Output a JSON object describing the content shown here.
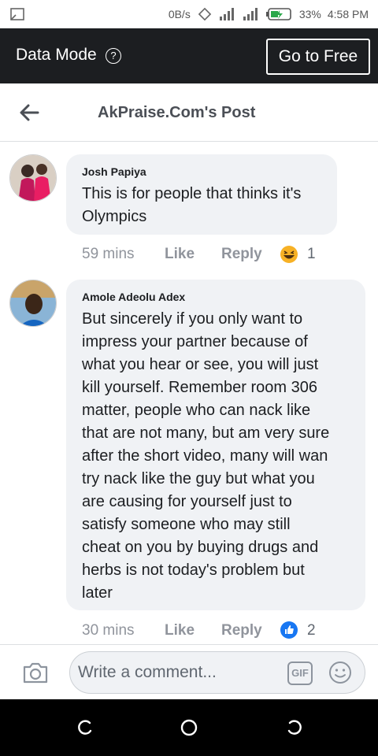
{
  "status_bar": {
    "network_speed": "0B/s",
    "battery": "33%",
    "time": "4:58 PM"
  },
  "data_mode_bar": {
    "label": "Data Mode",
    "cta_label": "Go to Free"
  },
  "header": {
    "title": "AkPraise.Com's Post"
  },
  "comments": [
    {
      "author": "Josh Papiya",
      "text_lines": [
        "This is for people that thinks it's",
        "Olympics"
      ],
      "time": "59 mins",
      "like_label": "Like",
      "reply_label": "Reply",
      "reaction_icon": "haha-emoji-icon",
      "reaction_count": "1"
    },
    {
      "author": "Amole Adeolu Adex",
      "text_lines": [
        "But sincerely if you only want to",
        "impress your partner because of",
        "what you hear or see, you will just",
        "kill yourself. Remember room 306",
        "matter, people who can nack like",
        "that are not many, but am very sure",
        "after the short video, many will wan",
        "try nack like the guy but what you",
        "are causing for yourself just to",
        "satisfy someone who may still",
        "cheat on you by buying drugs and",
        "herbs is not today's problem but",
        "later"
      ],
      "time": "30 mins",
      "like_label": "Like",
      "reply_label": "Reply",
      "reaction_icon": "like-thumb-icon",
      "reaction_count": "2"
    }
  ],
  "composer": {
    "placeholder": "Write a comment...",
    "gif_label": "GIF"
  },
  "colors": {
    "data_bar_bg": "#1c1e21",
    "bubble_bg": "#f0f2f5",
    "like_blue": "#1877f2",
    "haha_yellow": "#f7b125"
  }
}
